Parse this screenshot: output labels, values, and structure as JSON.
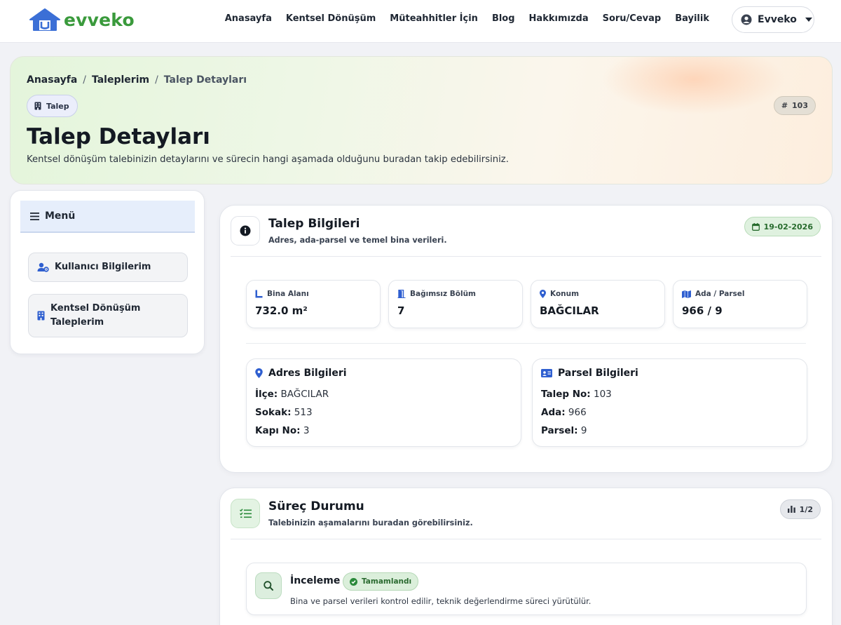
{
  "brand": {
    "name": "evveko",
    "color": "#3a9a3c",
    "icon_color": "#3b6fd6"
  },
  "nav": {
    "links": [
      "Anasayfa",
      "Kentsel Dönüşüm",
      "Müteahhitler İçin",
      "Blog",
      "Hakkımızda",
      "Soru/Cevap",
      "Bayilik"
    ],
    "user_name": "Evveko"
  },
  "hero": {
    "breadcrumb": [
      "Anasayfa",
      "Taleplerim",
      "Talep Detayları"
    ],
    "badge": "Talep",
    "id_label": "103",
    "title": "Talep Detayları",
    "subtitle": "Kentsel dönüşüm talebinizin detaylarını ve sürecin hangi aşamada olduğunu buradan takip edebilirsiniz."
  },
  "sidebar": {
    "heading": "Menü",
    "items": [
      {
        "label": "Kullanıcı Bilgilerim",
        "icon": "user-gear-icon"
      },
      {
        "label": "Kentsel Dönüşüm Taleplerim",
        "icon": "building-icon"
      }
    ]
  },
  "info_card": {
    "title": "Talep Bilgileri",
    "subtitle": "Adres, ada-parsel ve temel bina verileri.",
    "date": "19-02-2026",
    "stats": [
      {
        "label": "Bina Alanı",
        "value": "732.0 m²",
        "icon": "ruler-icon"
      },
      {
        "label": "Bağımsız Bölüm",
        "value": "7",
        "icon": "door-icon"
      },
      {
        "label": "Konum",
        "value": "BAĞCILAR",
        "icon": "location-pin-icon"
      },
      {
        "label": "Ada / Parsel",
        "value": "966 / 9",
        "icon": "map-icon"
      }
    ],
    "address": {
      "title": "Adres Bilgileri",
      "rows": [
        {
          "key": "İlçe:",
          "value": "BAĞCILAR"
        },
        {
          "key": "Sokak:",
          "value": "513"
        },
        {
          "key": "Kapı No:",
          "value": "3"
        }
      ]
    },
    "parcel": {
      "title": "Parsel Bilgileri",
      "rows": [
        {
          "key": "Talep No:",
          "value": "103"
        },
        {
          "key": "Ada:",
          "value": "966"
        },
        {
          "key": "Parsel:",
          "value": "9"
        }
      ]
    }
  },
  "status_card": {
    "title": "Süreç Durumu",
    "subtitle": "Talebinizin aşamalarını buradan görebilirsiniz.",
    "progress": "1/2",
    "steps": [
      {
        "title": "İnceleme",
        "badge": "Tamamlandı",
        "description": "Bina ve parsel verileri kontrol edilir, teknik değerlendirme süreci yürütülür."
      }
    ]
  },
  "colors": {
    "accent_blue": "#2f5fd0",
    "success_green": "#2a8a3a",
    "page_bg": "#f1f2f6"
  }
}
